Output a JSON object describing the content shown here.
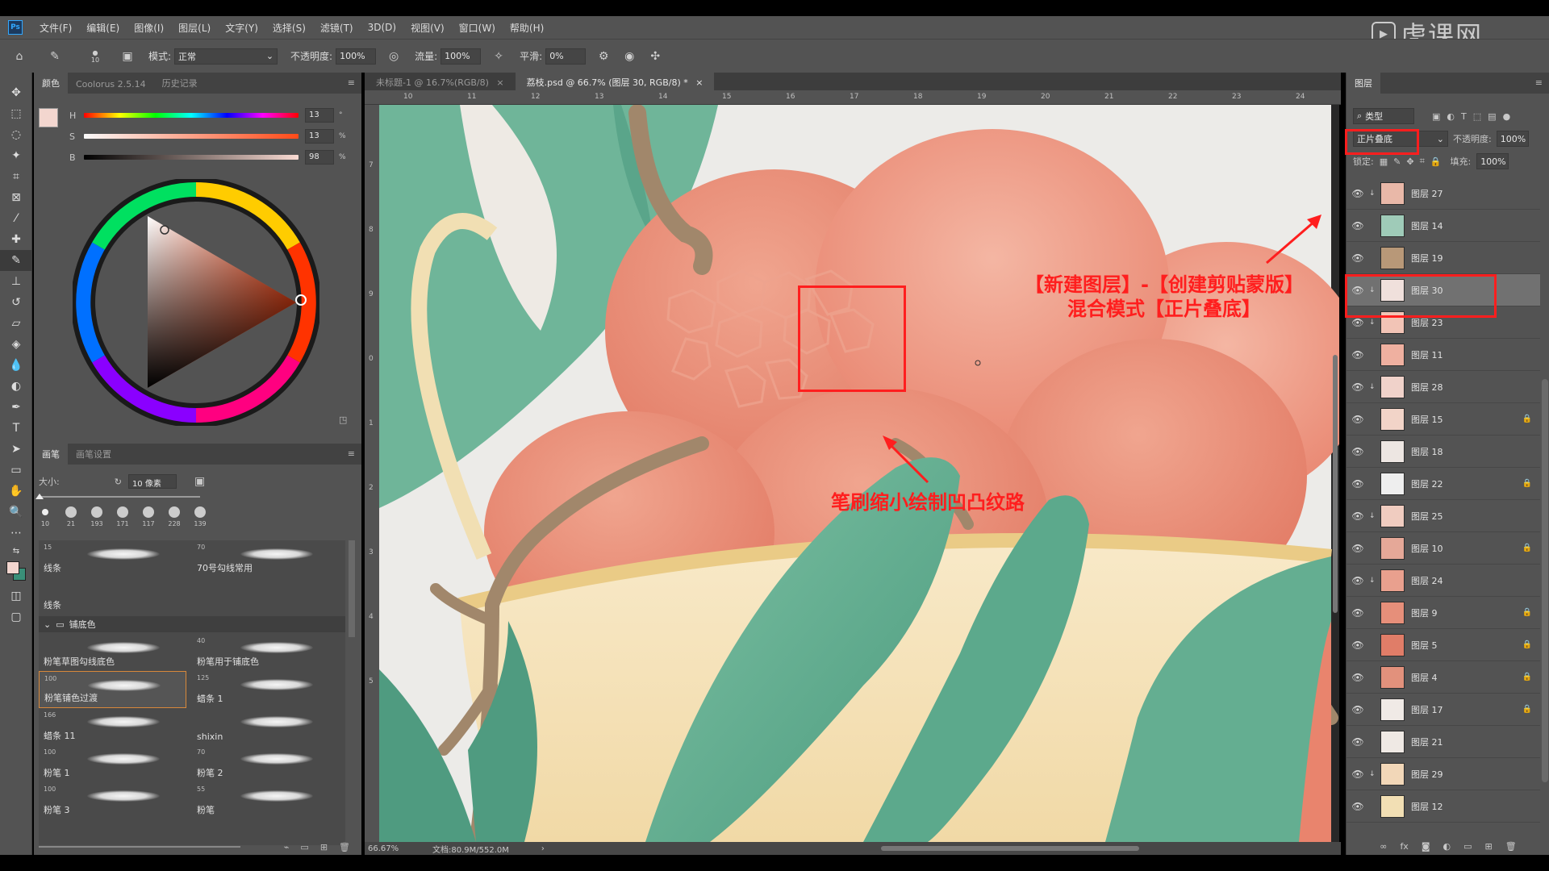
{
  "app": {
    "logo": "Ps",
    "watermark": "虎课网"
  },
  "menu": [
    "文件(F)",
    "编辑(E)",
    "图像(I)",
    "图层(L)",
    "文字(Y)",
    "选择(S)",
    "滤镜(T)",
    "3D(D)",
    "视图(V)",
    "窗口(W)",
    "帮助(H)"
  ],
  "options": {
    "brush_size": "10",
    "mode_label": "模式:",
    "mode_value": "正常",
    "opacity_label": "不透明度:",
    "opacity_value": "100%",
    "flow_label": "流量:",
    "flow_value": "100%",
    "smooth_label": "平滑:",
    "smooth_value": "0%"
  },
  "color_panel": {
    "tabs": [
      "颜色",
      "Coolorus 2.5.14",
      "历史记录"
    ],
    "sliders": [
      {
        "label": "H",
        "value": "13",
        "unit": "°"
      },
      {
        "label": "S",
        "value": "13",
        "unit": "%"
      },
      {
        "label": "B",
        "value": "98",
        "unit": "%"
      }
    ],
    "foreground_color": "#f3d6cf",
    "background_color": "#3a8f78"
  },
  "brush_panel": {
    "tabs": [
      "画笔",
      "画笔设置"
    ],
    "size_label": "大小:",
    "size_value": "10 像素",
    "preset_sizes": [
      "10",
      "21",
      "193",
      "171",
      "117",
      "228",
      "139"
    ],
    "group_name": "铺底色",
    "brushes_top": [
      {
        "size": "15",
        "name": "线条"
      },
      {
        "size": "70",
        "name": "70号勾线常用"
      },
      {
        "size": "",
        "name": "线条"
      }
    ],
    "brushes": [
      {
        "size": "",
        "name": "粉笔草图勾线底色"
      },
      {
        "size": "40",
        "name": "粉笔用于铺底色"
      },
      {
        "size": "100",
        "name": "粉笔铺色过渡"
      },
      {
        "size": "125",
        "name": "蜡条 1"
      },
      {
        "size": "166",
        "name": "蜡条 11"
      },
      {
        "size": "",
        "name": "shixin"
      },
      {
        "size": "100",
        "name": "粉笔 1"
      },
      {
        "size": "70",
        "name": "粉笔 2"
      },
      {
        "size": "100",
        "name": "粉笔 3"
      },
      {
        "size": "55",
        "name": "粉笔"
      }
    ]
  },
  "documents": {
    "tabs": [
      {
        "label": "未标题-1 @ 16.7%(RGB/8)",
        "close": "×"
      },
      {
        "label": "荔枝.psd @ 66.7% (图层 30, RGB/8) *",
        "close": "×"
      }
    ],
    "ruler_ticks": [
      "10",
      "11",
      "12",
      "13",
      "14",
      "15",
      "16",
      "17",
      "18",
      "19",
      "20",
      "21",
      "22",
      "23",
      "24"
    ],
    "ruler_left_ticks": [
      "7",
      "8",
      "9",
      "0",
      "1",
      "2",
      "3",
      "4",
      "5"
    ],
    "zoom": "66.67%",
    "doc_info": "文档:80.9M/552.0M"
  },
  "annotations": {
    "line1": "【新建图层】-【创建剪贴蒙版】",
    "line2": "混合模式【正片叠底】",
    "brush_note": "笔刷缩小绘制凹凸纹路"
  },
  "layers_panel": {
    "tab": "图层",
    "filter_value": "类型",
    "blend_mode": "正片叠底",
    "opacity_label": "不透明度:",
    "opacity_value": "100%",
    "lock_label": "锁定:",
    "fill_label": "填充:",
    "fill_value": "100%",
    "layers": [
      {
        "name": "图层 27",
        "clip": true,
        "locked": false,
        "active": false
      },
      {
        "name": "图层 14",
        "clip": false,
        "locked": false,
        "active": false
      },
      {
        "name": "图层 19",
        "clip": false,
        "locked": false,
        "active": false
      },
      {
        "name": "图层 30",
        "clip": true,
        "locked": false,
        "active": true
      },
      {
        "name": "图层 23",
        "clip": true,
        "locked": false,
        "active": false
      },
      {
        "name": "图层 11",
        "clip": false,
        "locked": false,
        "active": false
      },
      {
        "name": "图层 28",
        "clip": true,
        "locked": false,
        "active": false
      },
      {
        "name": "图层 15",
        "clip": false,
        "locked": true,
        "active": false
      },
      {
        "name": "图层 18",
        "clip": false,
        "locked": false,
        "active": false
      },
      {
        "name": "图层 22",
        "clip": false,
        "locked": true,
        "active": false
      },
      {
        "name": "图层 25",
        "clip": true,
        "locked": false,
        "active": false
      },
      {
        "name": "图层 10",
        "clip": false,
        "locked": true,
        "active": false
      },
      {
        "name": "图层 24",
        "clip": true,
        "locked": false,
        "active": false
      },
      {
        "name": "图层 9",
        "clip": false,
        "locked": true,
        "active": false
      },
      {
        "name": "图层 5",
        "clip": false,
        "locked": true,
        "active": false
      },
      {
        "name": "图层 4",
        "clip": false,
        "locked": true,
        "active": false
      },
      {
        "name": "图层 17",
        "clip": false,
        "locked": true,
        "active": false
      },
      {
        "name": "图层 21",
        "clip": false,
        "locked": false,
        "active": false
      },
      {
        "name": "图层 29",
        "clip": true,
        "locked": false,
        "active": false
      },
      {
        "name": "图层 12",
        "clip": false,
        "locked": false,
        "active": false
      }
    ]
  }
}
